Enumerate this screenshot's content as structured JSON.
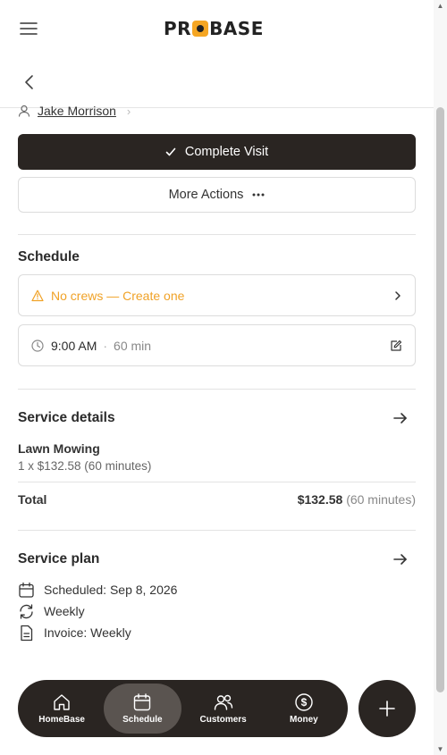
{
  "header": {
    "logo_text_left": "PR",
    "logo_text_right": "BASE"
  },
  "customer": {
    "name": "Jake Morrison"
  },
  "actions": {
    "complete_label": "Complete Visit",
    "more_label": "More Actions"
  },
  "schedule": {
    "title": "Schedule",
    "crew_warning": "No crews — Create one",
    "time": "9:00 AM",
    "separator": "·",
    "duration": "60 min"
  },
  "service_details": {
    "title": "Service details",
    "name": "Lawn Mowing",
    "detail": "1 x $132.58 (60 minutes)",
    "total_label": "Total",
    "total_amount": "$132.58",
    "total_duration": "(60 minutes)"
  },
  "service_plan": {
    "title": "Service plan",
    "scheduled": "Scheduled: Sep 8, 2026",
    "frequency": "Weekly",
    "invoice": "Invoice: Weekly"
  },
  "nav": {
    "items": [
      {
        "label": "HomeBase",
        "icon": "home-icon",
        "active": false
      },
      {
        "label": "Schedule",
        "icon": "calendar-icon",
        "active": true
      },
      {
        "label": "Customers",
        "icon": "users-icon",
        "active": false
      },
      {
        "label": "Money",
        "icon": "dollar-icon",
        "active": false
      }
    ],
    "fab_icon": "plus-icon"
  },
  "colors": {
    "primary_dark": "#2a2522",
    "warning": "#f0a227",
    "brand_accent": "#f5a623"
  }
}
